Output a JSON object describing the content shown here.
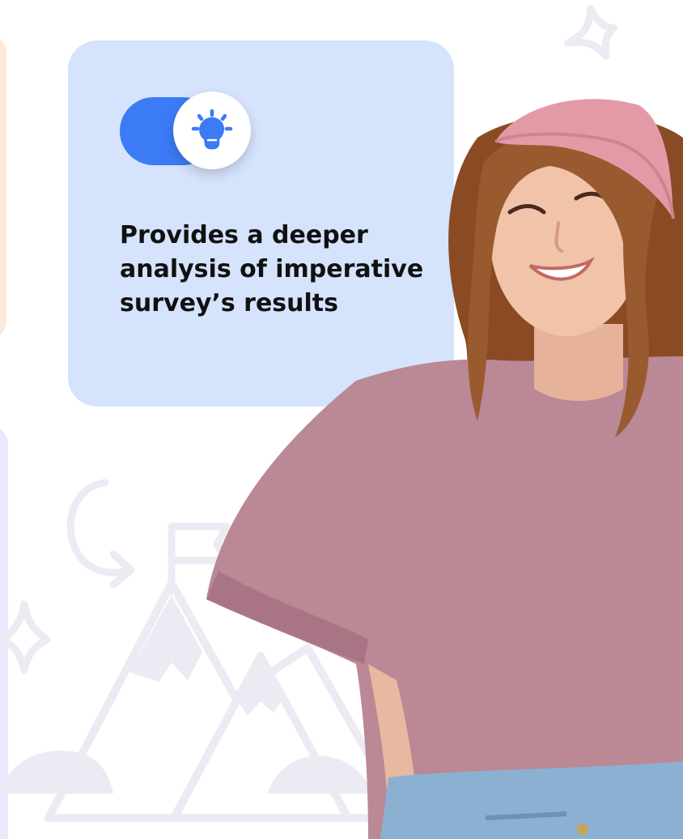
{
  "feature_card": {
    "text": "Provides a deeper analysis of imperative survey’s results",
    "toggle_icon": "lightbulb-icon",
    "toggle_state": "on"
  },
  "colors": {
    "card_background": "#d6e3fc",
    "toggle_track": "#3b7bf6",
    "toggle_knob": "#ffffff",
    "icon_accent": "#3b7bf6",
    "left_card_top": "#fde9da",
    "left_card_bottom": "#ebe7fc",
    "doodle": "#ecebf4"
  },
  "illustration": {
    "doodles": [
      "sparkle-icon",
      "curved-arrow-icon",
      "mountain-icon",
      "flag-icon",
      "cloud-icon"
    ],
    "person": "smiling-woman-photo"
  }
}
